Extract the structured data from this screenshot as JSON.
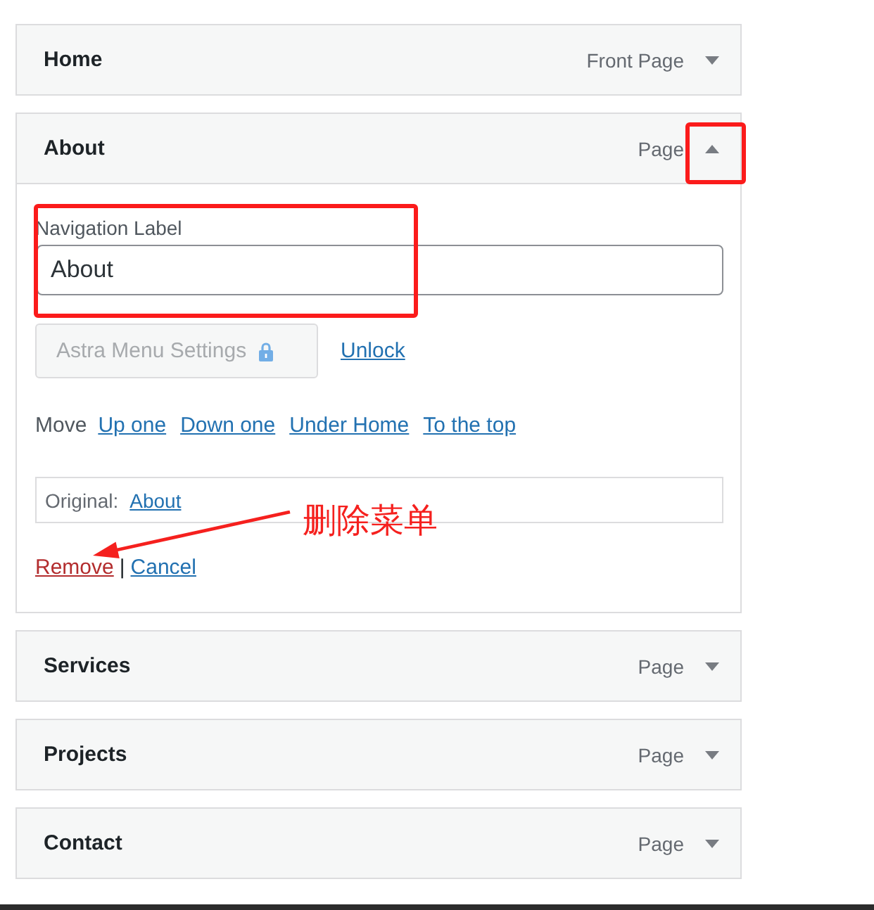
{
  "menu_items": [
    {
      "title": "Home",
      "item_type": "Front Page",
      "expanded": false,
      "toggle_highlighted": false
    },
    {
      "title": "About",
      "item_type": "Page",
      "expanded": true,
      "toggle_highlighted": true,
      "settings": {
        "navigation_label": {
          "label": "Navigation Label",
          "value": "About",
          "highlighted": true
        },
        "astra_button": {
          "label": "Astra Menu Settings",
          "disabled": true
        },
        "unlock_link": "Unlock",
        "move": {
          "label": "Move",
          "links": [
            "Up one",
            "Down one",
            "Under Home",
            "To the top"
          ]
        },
        "original": {
          "label": "Original:",
          "link": "About"
        },
        "actions": {
          "remove": "Remove",
          "separator": "|",
          "cancel": "Cancel"
        },
        "annotation": {
          "text": "删除菜单"
        }
      }
    },
    {
      "title": "Services",
      "item_type": "Page",
      "expanded": false,
      "toggle_highlighted": false
    },
    {
      "title": "Projects",
      "item_type": "Page",
      "expanded": false,
      "toggle_highlighted": false
    },
    {
      "title": "Contact",
      "item_type": "Page",
      "expanded": false,
      "toggle_highlighted": false
    }
  ]
}
